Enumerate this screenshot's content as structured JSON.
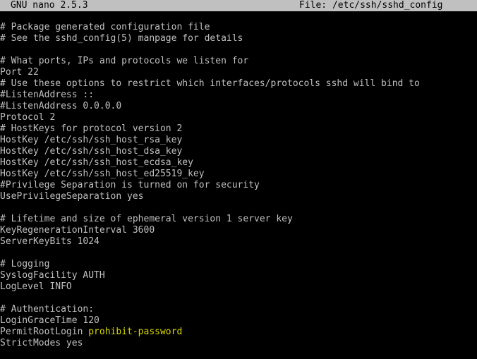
{
  "titlebar": {
    "app": "GNU nano 2.5.3",
    "file": "File: /etc/ssh/sshd_config"
  },
  "colors": {
    "background": "#000000",
    "text": "#c0c0c0",
    "titlebar_bg": "#c0c0c0",
    "titlebar_text": "#000000",
    "highlight": "#d7d700"
  },
  "lines": [
    {
      "text": "# Package generated configuration file"
    },
    {
      "text": "# See the sshd_config(5) manpage for details"
    },
    {
      "text": ""
    },
    {
      "text": "# What ports, IPs and protocols we listen for"
    },
    {
      "text": "Port 22"
    },
    {
      "text": "# Use these options to restrict which interfaces/protocols sshd will bind to"
    },
    {
      "text": "#ListenAddress ::"
    },
    {
      "text": "#ListenAddress 0.0.0.0"
    },
    {
      "text": "Protocol 2"
    },
    {
      "text": "# HostKeys for protocol version 2"
    },
    {
      "text": "HostKey /etc/ssh/ssh_host_rsa_key"
    },
    {
      "text": "HostKey /etc/ssh/ssh_host_dsa_key"
    },
    {
      "text": "HostKey /etc/ssh/ssh_host_ecdsa_key"
    },
    {
      "text": "HostKey /etc/ssh/ssh_host_ed25519_key"
    },
    {
      "text": "#Privilege Separation is turned on for security"
    },
    {
      "text": "UsePrivilegeSeparation yes"
    },
    {
      "text": ""
    },
    {
      "text": "# Lifetime and size of ephemeral version 1 server key"
    },
    {
      "text": "KeyRegenerationInterval 3600"
    },
    {
      "text": "ServerKeyBits 1024"
    },
    {
      "text": ""
    },
    {
      "text": "# Logging"
    },
    {
      "text": "SyslogFacility AUTH"
    },
    {
      "text": "LogLevel INFO"
    },
    {
      "text": ""
    },
    {
      "text": "# Authentication:"
    },
    {
      "text": "LoginGraceTime 120"
    },
    {
      "text": "PermitRootLogin ",
      "highlight": "prohibit-password"
    },
    {
      "text": "StrictModes yes"
    }
  ]
}
